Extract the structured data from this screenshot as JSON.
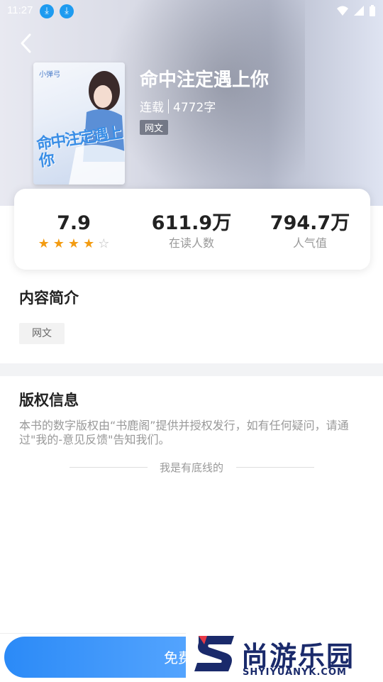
{
  "status_bar": {
    "time": "11:27"
  },
  "book": {
    "title": "命中注定遇上你",
    "status": "连载",
    "word_count": "4772字",
    "tag": "网文",
    "cover_title": "命中注定遇上你",
    "cover_author": "小弹弓"
  },
  "stats": {
    "rating": "7.9",
    "stars_filled": 4,
    "stars_total": 5,
    "readers_value": "611.9万",
    "readers_label": "在读人数",
    "popularity_value": "794.7万",
    "popularity_label": "人气值"
  },
  "intro": {
    "title": "内容简介",
    "tag": "网文"
  },
  "copyright": {
    "title": "版权信息",
    "text": "本书的数字版权由“书鹿阁”提供并授权发行，如有任何疑问，请通过\"我的-意见反馈\"告知我们。"
  },
  "end_marker": "我是有底线的",
  "bottom_button": {
    "label": "免费"
  },
  "watermark": {
    "cn": "尚游乐园",
    "en": "SHYIYUANYK.COM"
  },
  "colors": {
    "accent": "#2b8af7",
    "star": "#f39c12"
  }
}
